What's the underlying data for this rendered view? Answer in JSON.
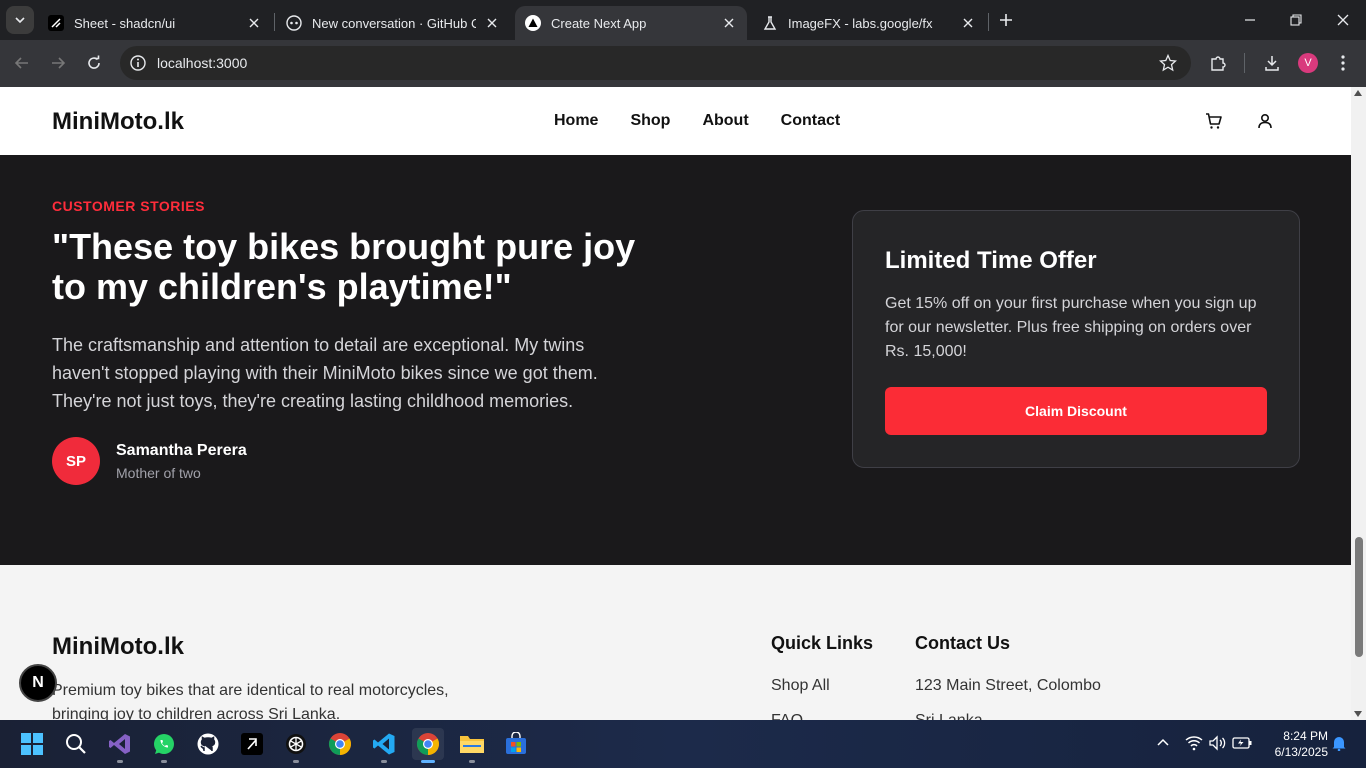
{
  "browser": {
    "tabs": [
      {
        "title": "Sheet - shadcn/ui",
        "active": false
      },
      {
        "title": "New conversation · GitHub Cop",
        "active": false
      },
      {
        "title": "Create Next App",
        "active": true
      },
      {
        "title": "ImageFX - labs.google/fx",
        "active": false
      }
    ],
    "url": "localhost:3000",
    "profile_initial": "V",
    "profile_color": "#d93a7d"
  },
  "site": {
    "logo": "MiniMoto.lk",
    "nav": [
      "Home",
      "Shop",
      "About",
      "Contact"
    ],
    "icons": [
      "cart-icon",
      "user-icon"
    ]
  },
  "testimonial": {
    "eyebrow": "CUSTOMER STORIES",
    "quote": "\"These toy bikes brought pure joy to my children's playtime!\"",
    "body": "The craftsmanship and attention to detail are exceptional. My twins haven't stopped playing with their MiniMoto bikes since we got them. They're not just toys, they're creating lasting childhood memories.",
    "avatar_initials": "SP",
    "author_name": "Samantha Perera",
    "author_role": "Mother of two"
  },
  "offer": {
    "title": "Limited Time Offer",
    "text": "Get 15% off on your first purchase when you sign up for our newsletter. Plus free shipping on orders over Rs. 15,000!",
    "button": "Claim Discount"
  },
  "footer": {
    "logo": "MiniMoto.lk",
    "description": "Premium toy bikes that are identical to real motorcycles, bringing joy to children across Sri Lanka.",
    "quick_links_title": "Quick Links",
    "quick_links": [
      "Shop All",
      "FAQ"
    ],
    "contact_title": "Contact Us",
    "contact": [
      "123 Main Street, Colombo",
      "Sri Lanka"
    ]
  },
  "dev_badge": "N",
  "taskbar": {
    "apps": [
      "windows-start",
      "search",
      "visual-studio",
      "whatsapp",
      "github-desktop",
      "cursor",
      "chatgpt",
      "chrome",
      "vscode",
      "chrome-active",
      "file-explorer",
      "microsoft-store"
    ],
    "time": "8:24 PM",
    "date": "6/13/2025"
  },
  "colors": {
    "accent": "#fb2c36",
    "dark_section": "#1a191b",
    "footer_bg": "#f4f4f4"
  }
}
